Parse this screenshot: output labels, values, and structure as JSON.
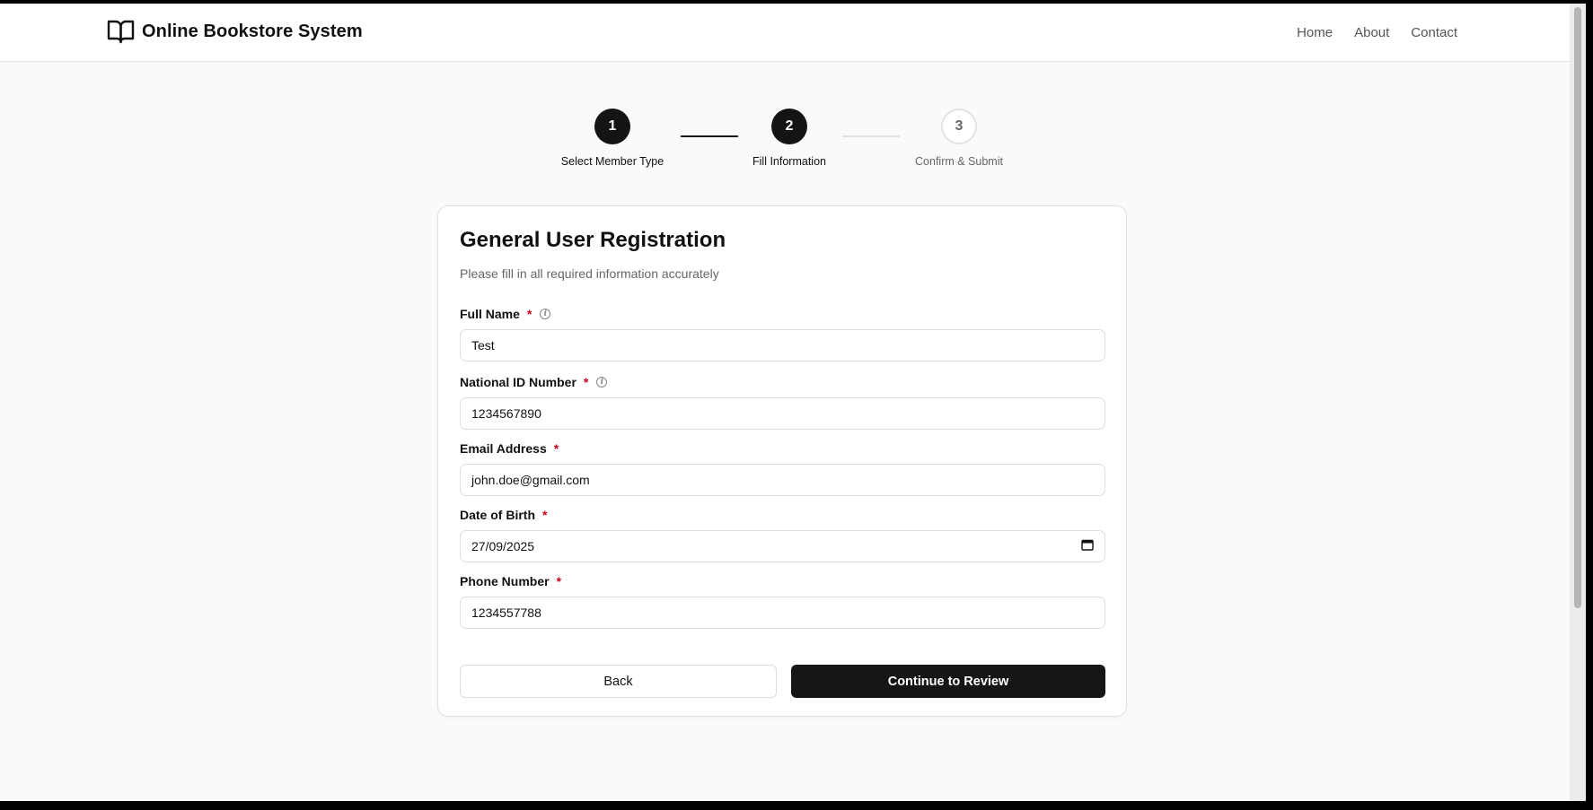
{
  "header": {
    "brand_title": "Online Bookstore System",
    "nav": [
      "Home",
      "About",
      "Contact"
    ]
  },
  "stepper": {
    "steps": [
      {
        "number": "1",
        "label": "Select Member Type",
        "state": "completed"
      },
      {
        "number": "2",
        "label": "Fill Information",
        "state": "current"
      },
      {
        "number": "3",
        "label": "Confirm & Submit",
        "state": "pending"
      }
    ]
  },
  "form": {
    "title": "General User Registration",
    "subtitle": "Please fill in all required information accurately",
    "required_marker": "*",
    "fields": [
      {
        "label": "Full Name",
        "value": "Test",
        "has_info": true
      },
      {
        "label": "National ID Number",
        "value": "1234567890",
        "has_info": true
      },
      {
        "label": "Email Address",
        "value": "john.doe@gmail.com",
        "has_info": false
      },
      {
        "label": "Date of Birth",
        "value": "27/09/2025",
        "has_info": false,
        "type": "date"
      },
      {
        "label": "Phone Number",
        "value": "1234557788",
        "has_info": false
      }
    ],
    "back_label": "Back",
    "continue_label": "Continue to Review"
  },
  "icons": {
    "brand": "open-book-icon",
    "info": "info-circle-icon",
    "date": "calendar-icon"
  },
  "colors": {
    "accent": "#141414",
    "required": "#d0021b",
    "page_background": "#fafafa"
  }
}
